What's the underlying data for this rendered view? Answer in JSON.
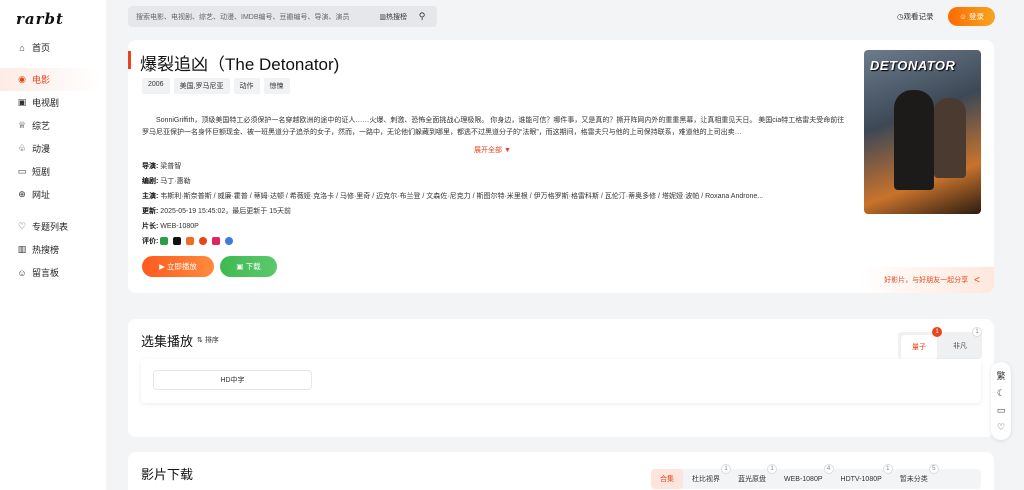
{
  "sidebar": {
    "logo": "rarbt",
    "items": [
      {
        "label": "首页",
        "icon": "⌂"
      },
      {
        "label": "电影",
        "icon": "◉"
      },
      {
        "label": "电视剧",
        "icon": "▣"
      },
      {
        "label": "综艺",
        "icon": "♕"
      },
      {
        "label": "动漫",
        "icon": "♧"
      },
      {
        "label": "短剧",
        "icon": "▭"
      },
      {
        "label": "网址",
        "icon": "⊕"
      },
      {
        "label": "专题列表",
        "icon": "♡"
      },
      {
        "label": "热搜榜",
        "icon": "▥"
      },
      {
        "label": "留言板",
        "icon": "☺"
      }
    ]
  },
  "header": {
    "search_placeholder": "搜索电影、电视剧、综艺、动漫、IMDB编号、豆瓣编号、导演、演员",
    "hot_label": "热搜榜",
    "history_label": "观看记录",
    "login_label": "登录"
  },
  "movie": {
    "title": "爆裂追凶（The Detonator)",
    "tags": [
      "2006",
      "美国,罗马尼亚",
      "动作",
      "惊悚"
    ],
    "poster_title": "DETONATOR",
    "synopsis": "SonniGriffith，顶级美国特工必须保护一名穿越欧洲的途中的证人……火爆、刺激、恐怖全面挑战心理极限。 你身边，谁能可信？哪件事，又是真的？撕开阵网内外的重重黑幕，让真相重见天日。 美国cia特工格雷夫受命前往罗马尼亚保护一名身怀巨额现金、被一班黑道分子追杀的女子，然而，一路中，无论他们躲藏到哪里，都逃不过黑道分子的“法眼”，而这期间，格雷夫只与他的上司保持联系，难道他的上司出卖…",
    "expand_label": "展开全部",
    "director_label": "导演:",
    "director": "梁普智",
    "writer_label": "编剧:",
    "writer": "马丁·惠勒",
    "cast_label": "主演:",
    "cast": "韦斯利·斯奈普斯 / 威廉·霍普 / 蒂姆·达顿 / 希薇娅·克洛卡 / 马修·里奇 / 迈克尔·布兰登 / 文森佐·尼克力 / 斯图尔特·米里根 / 伊万格罗斯·格雷科斯 / 瓦伦汀·蒂奥多修 / 塔妮娅·波帕 / Roxana Androne...",
    "updated_label": "更新:",
    "updated": "2025-05-19 15:45:02，最后更新于 15天前",
    "length_label": "片长:",
    "length": "WEB-1080P",
    "rating_label": "评价:",
    "play_label": "立即播放",
    "download_label": "下载",
    "share_label": "好影片，与好朋友一起分享"
  },
  "episodes": {
    "title": "选集播放",
    "sort_label": "排序",
    "items": [
      "HD中字"
    ],
    "sources": [
      {
        "label": "量子",
        "count": "1"
      },
      {
        "label": "非凡",
        "count": "1"
      }
    ]
  },
  "downloads": {
    "title": "影片下载",
    "tabs": [
      {
        "label": "合集",
        "count": ""
      },
      {
        "label": "杜比视界",
        "count": "1"
      },
      {
        "label": "蓝光原盘",
        "count": "1"
      },
      {
        "label": "WEB-1080P",
        "count": "4"
      },
      {
        "label": "HDTV-1080P",
        "count": "1"
      },
      {
        "label": "暂未分类",
        "count": "5"
      }
    ]
  },
  "float_toolbar": {
    "traditional_label": "繁"
  },
  "colors": {
    "accent": "#e8441c",
    "green": "#3fb950"
  }
}
